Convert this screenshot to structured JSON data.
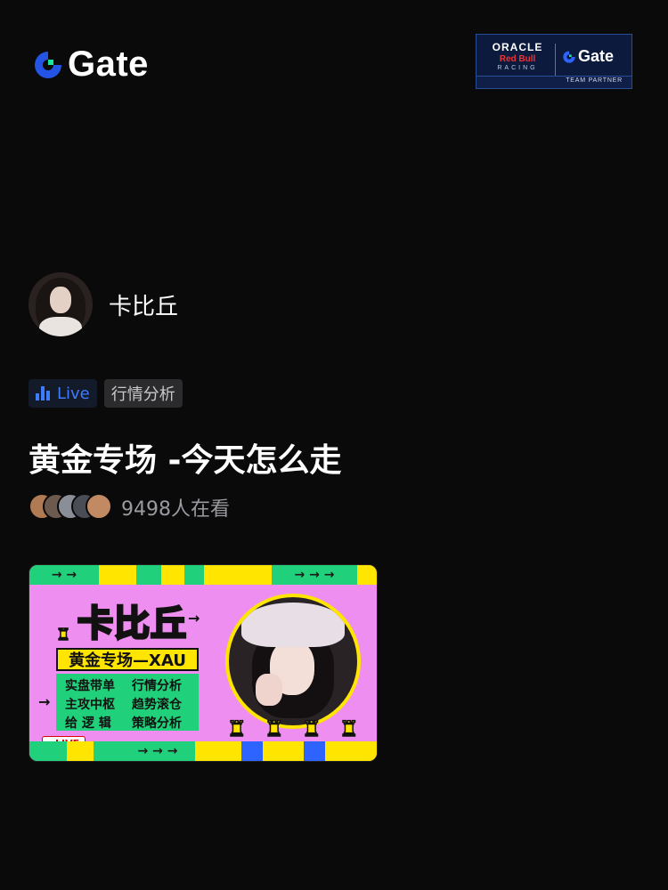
{
  "header": {
    "logo_text": "Gate",
    "partner": {
      "oracle": "ORACLE",
      "redbull": "Red Bull",
      "racing": "RACING",
      "gate": "Gate",
      "footer": "TEAM PARTNER"
    }
  },
  "host": {
    "name": "卡比丘"
  },
  "tags": {
    "live_label": "Live",
    "category": "行情分析"
  },
  "stream": {
    "title": "黄金专场 -今天怎么走",
    "viewer_count": "9498人在看"
  },
  "thumbnail": {
    "name": "卡比丘",
    "subject": "黄金专场—XAU",
    "features": [
      "实盘带单",
      "行情分析",
      "主攻中枢",
      "趋势滚仓",
      "给 逻 辑",
      "策略分析"
    ],
    "live_badge": "LIVE"
  },
  "colors": {
    "brand_blue": "#2354e6",
    "brand_green": "#17e6a1",
    "live_blue": "#3d7bff",
    "card_pink": "#ee8ef0",
    "card_yellow": "#ffe500",
    "card_green": "#21d07a"
  }
}
